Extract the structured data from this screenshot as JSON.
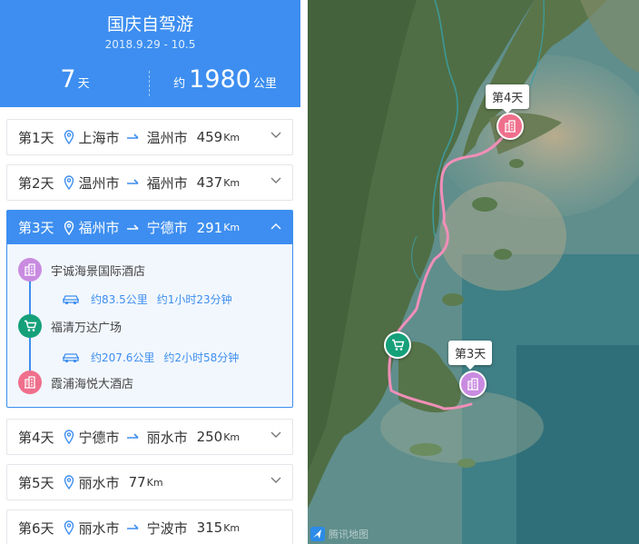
{
  "header": {
    "title": "国庆自驾游",
    "dates": "2018.9.29 - 10.5",
    "days_num": "7",
    "days_unit": "天",
    "dist_prefix": "约",
    "dist_num": "1980",
    "dist_unit": "公里"
  },
  "days": [
    {
      "label": "第1天",
      "from": "上海市",
      "to": "温州市",
      "km": "459",
      "unit": "Km"
    },
    {
      "label": "第2天",
      "from": "温州市",
      "to": "福州市",
      "km": "437",
      "unit": "Km"
    },
    {
      "label": "第3天",
      "from": "福州市",
      "to": "宁德市",
      "km": "291",
      "unit": "Km"
    },
    {
      "label": "第4天",
      "from": "宁德市",
      "to": "丽水市",
      "km": "250",
      "unit": "Km"
    },
    {
      "label": "第5天",
      "from": "丽水市",
      "to": "",
      "km": "77",
      "unit": "Km"
    },
    {
      "label": "第6天",
      "from": "丽水市",
      "to": "宁波市",
      "km": "315",
      "unit": "Km"
    }
  ],
  "day3_detail": {
    "stops": [
      {
        "name": "宇诚海景国际酒店",
        "icon": "hotel-icon",
        "color": "#c98be0"
      },
      {
        "name": "福清万达广场",
        "icon": "shopping-cart-icon",
        "color": "#15a07a"
      },
      {
        "name": "霞浦海悦大酒店",
        "icon": "hotel-icon",
        "color": "#ef6f8c"
      }
    ],
    "drives": [
      {
        "distance": "约83.5公里",
        "time": "约1小时23分钟"
      },
      {
        "distance": "约207.6公里",
        "time": "约2小时58分钟"
      }
    ]
  },
  "map": {
    "bubble_day4": "第4天",
    "bubble_day3": "第3天",
    "logo_text": "腾讯地图"
  },
  "colors": {
    "primary": "#3d8ef0",
    "route": "#f08fb8",
    "hotel_pink": "#ef6f8c",
    "hotel_purple": "#c98be0",
    "shop_green": "#15a07a"
  }
}
